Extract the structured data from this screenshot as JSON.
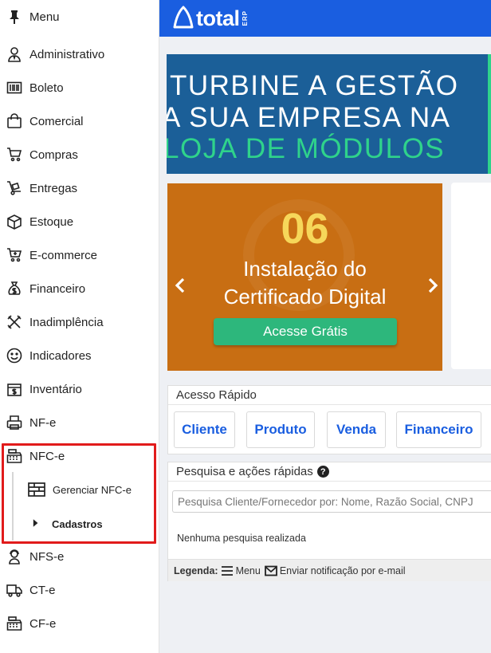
{
  "sidebar": {
    "menu_label": "Menu",
    "items": [
      {
        "label": "Administrativo",
        "icon": "user-tie-icon"
      },
      {
        "label": "Boleto",
        "icon": "barcode-icon"
      },
      {
        "label": "Comercial",
        "icon": "shopping-bag-icon"
      },
      {
        "label": "Compras",
        "icon": "cart-icon"
      },
      {
        "label": "Entregas",
        "icon": "dolly-icon"
      },
      {
        "label": "Estoque",
        "icon": "box-icon"
      },
      {
        "label": "E-commerce",
        "icon": "cart-plus-icon"
      },
      {
        "label": "Financeiro",
        "icon": "money-bag-icon"
      },
      {
        "label": "Inadimplência",
        "icon": "tools-icon"
      },
      {
        "label": "Indicadores",
        "icon": "smile-icon"
      },
      {
        "label": "Inventário",
        "icon": "box-dollar-icon"
      },
      {
        "label": "NF-e",
        "icon": "printer-icon"
      },
      {
        "label": "NFC-e",
        "icon": "cash-register-icon"
      },
      {
        "label": "NFS-e",
        "icon": "user-headset-icon"
      },
      {
        "label": "CT-e",
        "icon": "truck-icon"
      },
      {
        "label": "CF-e",
        "icon": "cash-register-icon"
      }
    ],
    "nfce_submenu": {
      "manage_label": "Gerenciar NFC-e",
      "cadastros_label": "Cadastros"
    }
  },
  "topbar": {
    "logo_text": "total",
    "logo_suffix": "ERP",
    "color": "#1a5ee0"
  },
  "banner": {
    "line1": "TURBINE A GESTÃO",
    "line2": "A SUA EMPRESA NA",
    "line3": "LOJA DE MÓDULOS"
  },
  "carousel": {
    "number": "06",
    "title_line1": "Instalação do",
    "title_line2": "Certificado Digital",
    "cta": "Acesse Grátis"
  },
  "quick_access": {
    "title": "Acesso Rápido",
    "buttons": [
      "Cliente",
      "Produto",
      "Venda",
      "Financeiro"
    ]
  },
  "search": {
    "title": "Pesquisa e ações rápidas",
    "placeholder": "Pesquisa Cliente/Fornecedor por: Nome, Razão Social, CNPJ",
    "empty_message": "Nenhuma pesquisa realizada",
    "legend_label": "Legenda:",
    "legend_menu": "Menu",
    "legend_email": "Enviar notificação por e-mail"
  }
}
